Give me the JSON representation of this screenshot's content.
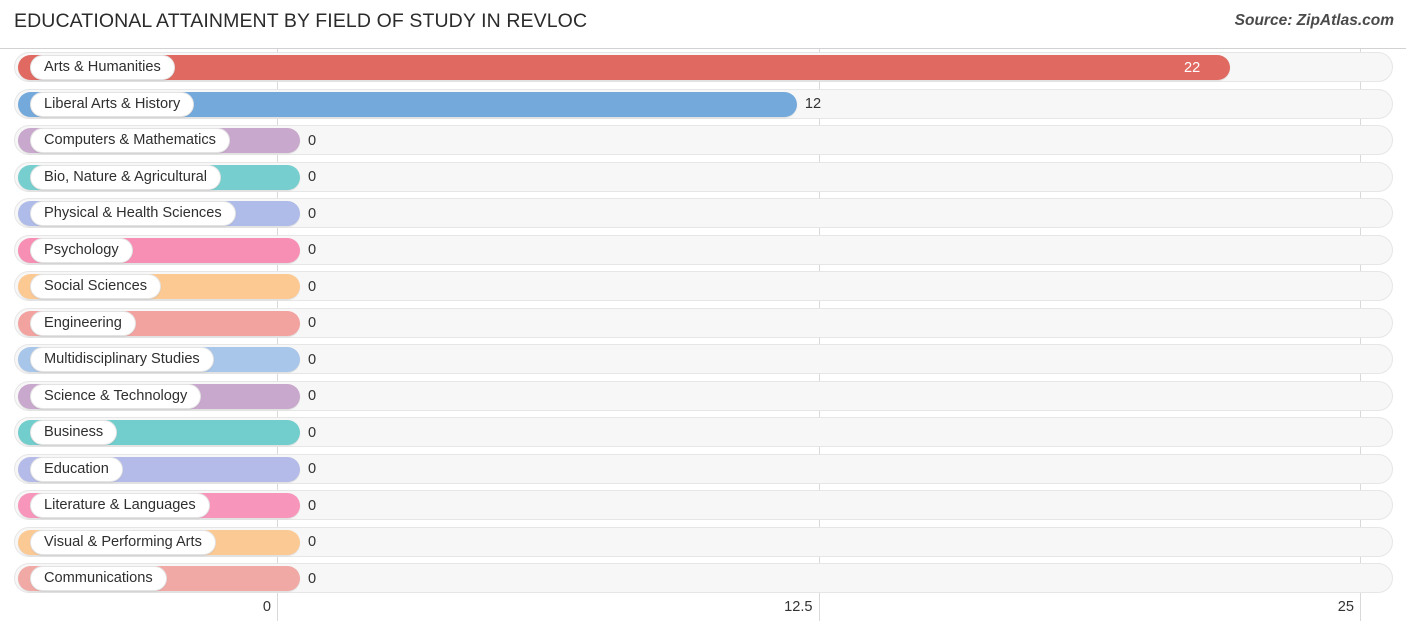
{
  "header": {
    "title": "EDUCATIONAL ATTAINMENT BY FIELD OF STUDY IN REVLOC",
    "source": "Source: ZipAtlas.com"
  },
  "chart_data": {
    "type": "bar",
    "orientation": "horizontal",
    "title": "EDUCATIONAL ATTAINMENT BY FIELD OF STUDY IN REVLOC",
    "xlabel": "",
    "ylabel": "",
    "xlim": [
      0,
      25
    ],
    "grid": true,
    "legend": "none",
    "axis_ticks": [
      "0",
      "12.5",
      "25"
    ],
    "axis_tick_values": [
      0,
      12.5,
      25
    ],
    "categories": [
      "Arts & Humanities",
      "Liberal Arts & History",
      "Computers & Mathematics",
      "Bio, Nature & Agricultural",
      "Physical & Health Sciences",
      "Psychology",
      "Social Sciences",
      "Engineering",
      "Multidisciplinary Studies",
      "Science & Technology",
      "Business",
      "Education",
      "Literature & Languages",
      "Visual & Performing Arts",
      "Communications"
    ],
    "values": [
      22,
      12,
      0,
      0,
      0,
      0,
      0,
      0,
      0,
      0,
      0,
      0,
      0,
      0,
      0
    ],
    "value_labels": [
      "22",
      "12",
      "0",
      "0",
      "0",
      "0",
      "0",
      "0",
      "0",
      "0",
      "0",
      "0",
      "0",
      "0",
      "0"
    ],
    "colors": [
      "#e06a62",
      "#74a9dc",
      "#c9a8cd",
      "#76cfce",
      "#afbbe8",
      "#f78fb4",
      "#fcc993",
      "#f2a3a0",
      "#a8c6e9",
      "#c9a8cd",
      "#72cdcd",
      "#b4bbe8",
      "#f895bb",
      "#fbc994",
      "#f0a9a5"
    ]
  }
}
